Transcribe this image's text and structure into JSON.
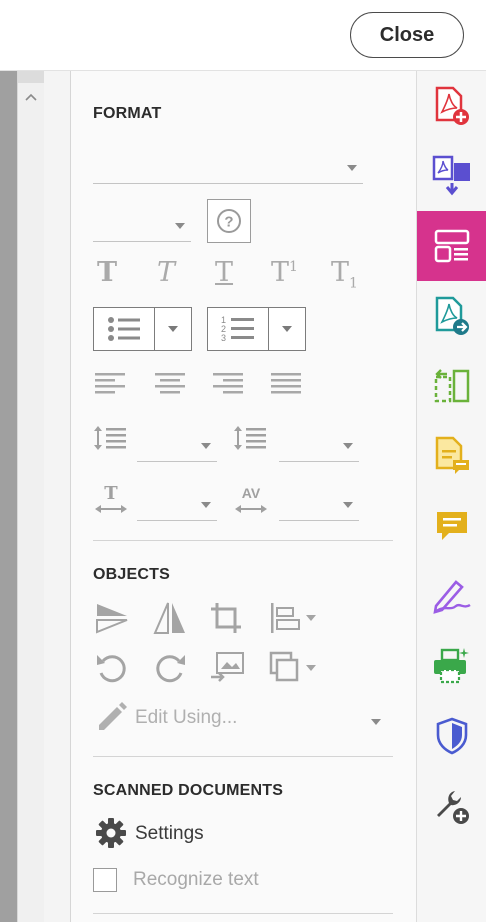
{
  "topbar": {
    "close_label": "Close"
  },
  "panel": {
    "format": {
      "title": "FORMAT",
      "text_styles": [
        "T",
        "T",
        "T",
        "T",
        "T"
      ],
      "text_style_sup": [
        "",
        "",
        "",
        "1",
        "1"
      ]
    },
    "objects": {
      "title": "OBJECTS",
      "edit_using_label": "Edit Using..."
    },
    "scanned": {
      "title": "SCANNED DOCUMENTS",
      "settings_label": "Settings",
      "recognize_label": "Recognize text"
    }
  },
  "colors": {
    "accent_active": "#d6338d",
    "create_pdf": "#e0343d",
    "combine": "#5b4fd0",
    "organize": "#d6338d",
    "export": "#1f9a9a",
    "organize_pages": "#6ab23a",
    "comment_doc": "#e3b01c",
    "comment": "#e3b01c",
    "fill_sign": "#9b5de5",
    "print_production": "#3aa84a",
    "protect": "#4a5bd0",
    "tools": "#4a4a4a"
  }
}
